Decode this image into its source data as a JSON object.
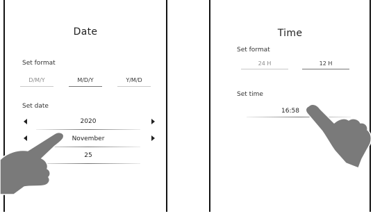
{
  "date_panel": {
    "title": "Date",
    "set_format_label": "Set format",
    "formats": [
      "D/M/Y",
      "M/D/Y",
      "Y/M/D"
    ],
    "set_date_label": "Set date",
    "year": "2020",
    "month": "November",
    "day": "25",
    "arrow_left_icon": "chevron-left-icon",
    "arrow_right_icon": "chevron-right-icon"
  },
  "time_panel": {
    "title": "Time",
    "set_format_label": "Set format",
    "formats": [
      "24 H",
      "12 H"
    ],
    "set_time_label": "Set time",
    "time_value": "16:58"
  },
  "colors": {
    "hand": "#7a7a7a",
    "panel_border": "#111111",
    "text": "#222222"
  }
}
